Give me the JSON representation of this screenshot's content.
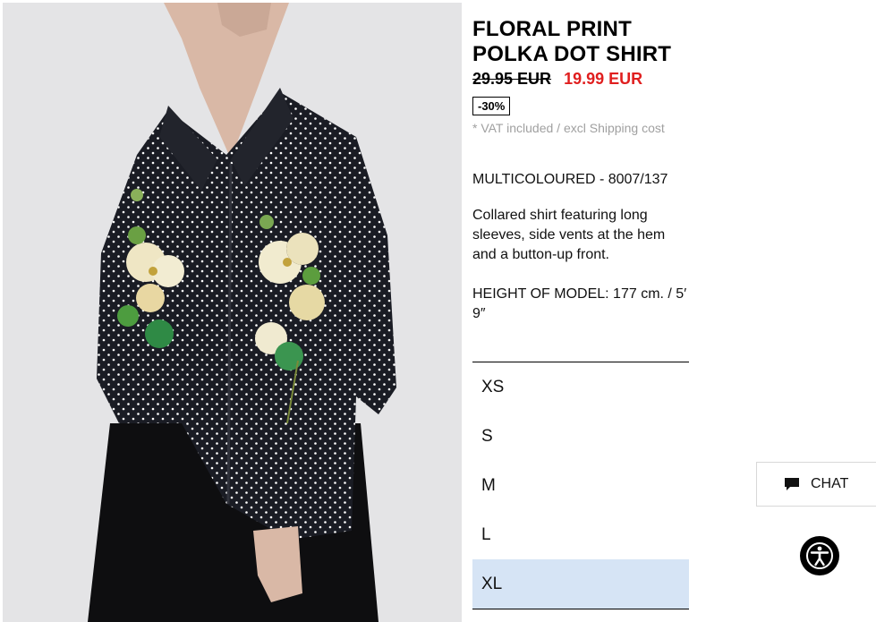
{
  "product": {
    "title": "FLORAL PRINT POLKA DOT SHIRT",
    "old_price": "29.95 EUR",
    "new_price": "19.99 EUR",
    "discount": "-30%",
    "vat_note": "* VAT included / excl Shipping cost",
    "color_ref": "MULTICOLOURED - 8007/137",
    "description": "Collared shirt featuring long sleeves, side vents at the hem and a button-up front.",
    "model_height": "HEIGHT OF MODEL: 177 cm. / 5′ 9″"
  },
  "sizes": [
    {
      "label": "XS"
    },
    {
      "label": "S"
    },
    {
      "label": "M"
    },
    {
      "label": "L"
    },
    {
      "label": "XL"
    }
  ],
  "selected_size": "XL",
  "chat": {
    "label": "CHAT",
    "icon": "chat-bubble-icon"
  },
  "accessibility": {
    "icon": "accessibility-icon"
  },
  "colors": {
    "sale_price": "#e01f1f",
    "selected_size_bg": "#d6e4f5",
    "shirt": "#1a1c24",
    "skirt": "#0e0e10",
    "backdrop": "#e4e4e6"
  }
}
